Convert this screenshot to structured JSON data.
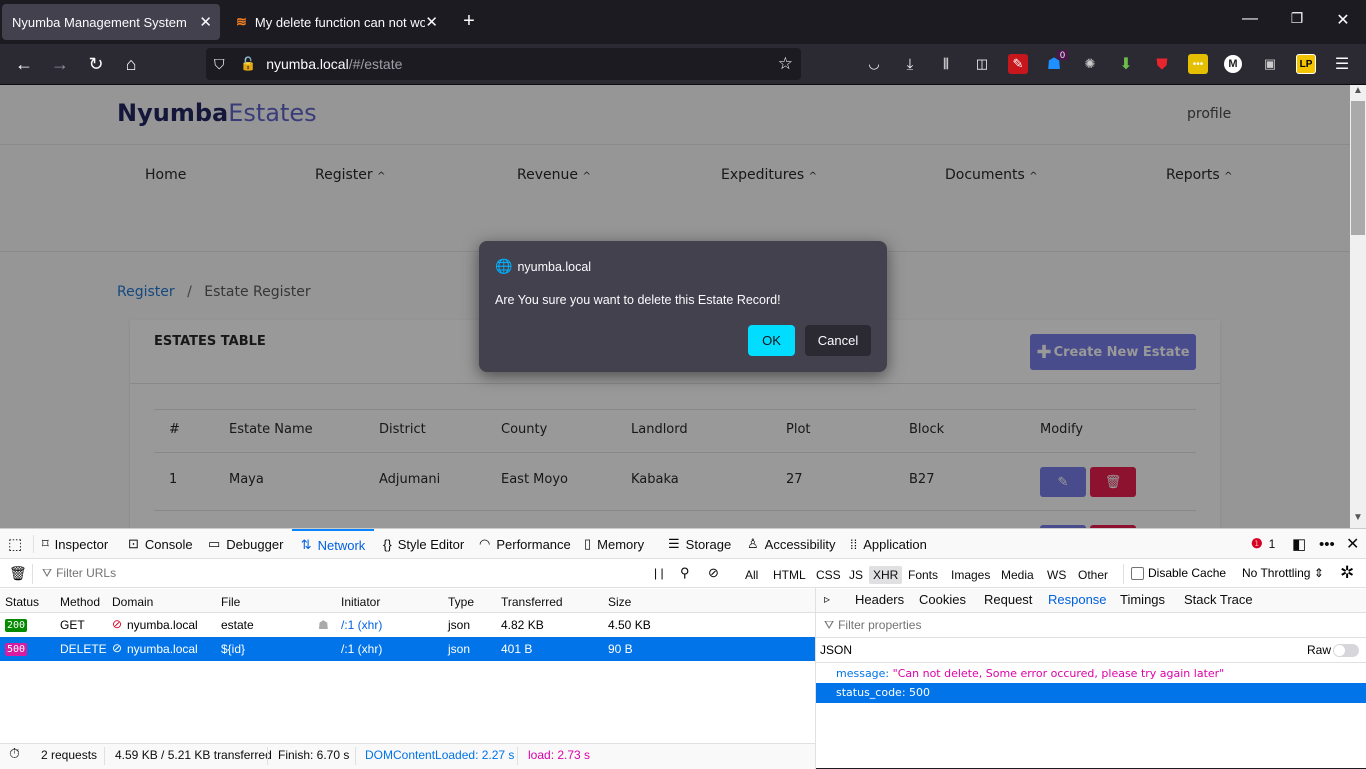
{
  "browser": {
    "tabs": [
      {
        "title": "Nyumba Management System",
        "active": true
      },
      {
        "title": "My delete function can not wor",
        "active": false
      }
    ],
    "new_tab_label": "+",
    "url_host": "nyumba.local",
    "url_path": "/#/estate",
    "extensions": [
      {
        "name": "pocket-icon"
      },
      {
        "name": "download-icon"
      },
      {
        "name": "library-icon"
      },
      {
        "name": "sidebar-icon"
      },
      {
        "name": "colorzilla-icon"
      },
      {
        "name": "ghostery-icon",
        "badge": "0"
      },
      {
        "name": "bug-extension-icon"
      },
      {
        "name": "download-arrow-extension-icon"
      },
      {
        "name": "shield-lock-extension-icon"
      },
      {
        "name": "password-extension-icon"
      },
      {
        "name": "m-extension-icon"
      },
      {
        "name": "window-extension-icon"
      },
      {
        "name": "lastpass-icon",
        "label": "LP"
      }
    ]
  },
  "site": {
    "logo_bold": "Nyumba",
    "logo_light": "Estates",
    "profile_label": "profile",
    "menu": [
      "Home",
      "Register",
      "Revenue",
      "Expeditures",
      "Documents",
      "Reports"
    ],
    "breadcrumb": {
      "parent": "Register",
      "separator": "/",
      "current": "Estate Register"
    },
    "card_title": "ESTATES TABLE",
    "create_button": "Create New Estate",
    "table": {
      "headers": [
        "#",
        "Estate Name",
        "District",
        "County",
        "Landlord",
        "Plot",
        "Block",
        "Modify"
      ],
      "rows": [
        [
          "1",
          "Maya",
          "Adjumani",
          "East Moyo",
          "Kabaka",
          "27",
          "B27"
        ]
      ]
    }
  },
  "dialog": {
    "origin": "nyumba.local",
    "message": "Are You sure you want to delete this Estate Record!",
    "ok_label": "OK",
    "cancel_label": "Cancel"
  },
  "devtools": {
    "tabs": [
      "Inspector",
      "Console",
      "Debugger",
      "Network",
      "Style Editor",
      "Performance",
      "Memory",
      "Storage",
      "Accessibility",
      "Application"
    ],
    "selected_tab": "Network",
    "error_count": "1",
    "filter_placeholder": "Filter URLs",
    "type_filters": [
      "All",
      "HTML",
      "CSS",
      "JS",
      "XHR",
      "Fonts",
      "Images",
      "Media",
      "WS",
      "Other"
    ],
    "selected_type": "XHR",
    "disable_cache_label": "Disable Cache",
    "throttling_label": "No Throttling",
    "columns": [
      "Status",
      "Method",
      "Domain",
      "File",
      "Initiator",
      "Type",
      "Transferred",
      "Size"
    ],
    "requests": [
      {
        "status": "200",
        "method": "GET",
        "domain": "nyumba.local",
        "file": "estate",
        "initiator": "/:1 (xhr)",
        "type": "json",
        "transferred": "4.82 KB",
        "size": "4.50 KB",
        "color": "#058b00"
      },
      {
        "status": "500",
        "method": "DELETE",
        "domain": "nyumba.local",
        "file": "${id}",
        "initiator": "/:1 (xhr)",
        "type": "json",
        "transferred": "401 B",
        "size": "90 B",
        "color": "#d91ba3"
      }
    ],
    "detail_tabs": [
      "Headers",
      "Cookies",
      "Request",
      "Response",
      "Timings",
      "Stack Trace"
    ],
    "selected_detail_tab": "Response",
    "filter_properties_placeholder": "Filter properties",
    "json_label": "JSON",
    "raw_label": "Raw",
    "response": [
      {
        "key": "message:",
        "value": "\"Can not delete, Some error occured, please try again later\""
      },
      {
        "key": "status_code:",
        "value": "500"
      }
    ],
    "summary": {
      "requests": "2 requests",
      "transferred": "4.59 KB / 5.21 KB transferred",
      "finish": "Finish: 6.70 s",
      "dom_loaded": "DOMContentLoaded: 2.27 s",
      "load": "load: 2.73 s"
    }
  }
}
